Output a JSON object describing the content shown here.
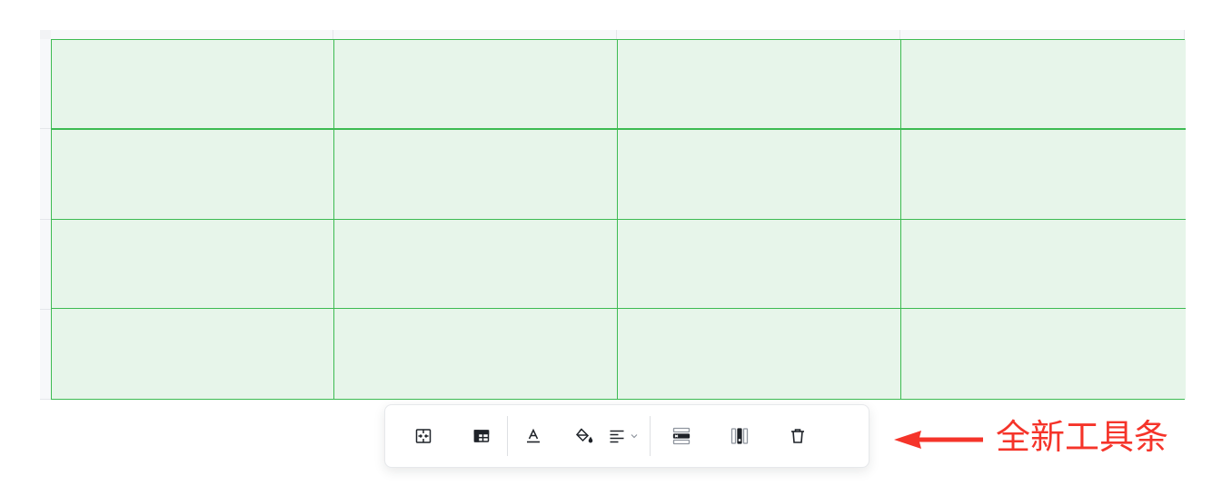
{
  "table": {
    "columns": 4,
    "rows": [
      [
        "",
        "",
        "",
        ""
      ],
      [
        "",
        "",
        "",
        ""
      ],
      [
        "",
        "",
        "",
        ""
      ],
      [
        "",
        "",
        "",
        ""
      ]
    ],
    "selection_color": "#3dbb52",
    "selection_fill": "#e7f5ea"
  },
  "toolbar": {
    "groups": [
      {
        "items": [
          {
            "icon": "merge-cells-icon"
          },
          {
            "icon": "table-header-icon"
          }
        ]
      },
      {
        "items": [
          {
            "icon": "text-color-icon"
          },
          {
            "icon": "fill-color-icon"
          },
          {
            "icon": "align-left-icon",
            "dropdown": true
          }
        ]
      },
      {
        "items": [
          {
            "icon": "delete-row-icon"
          },
          {
            "icon": "delete-column-icon"
          },
          {
            "icon": "trash-icon"
          }
        ]
      }
    ]
  },
  "annotation": {
    "label": "全新工具条",
    "color": "#f5342a"
  }
}
